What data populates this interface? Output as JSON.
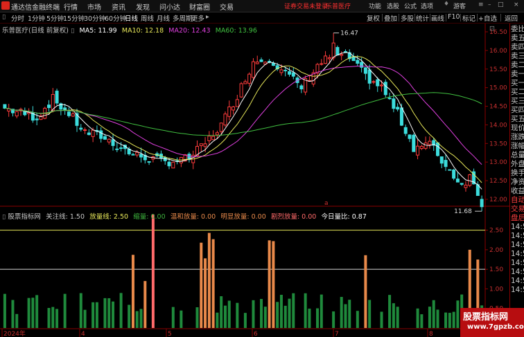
{
  "menubar": {
    "app_name": "通达信金融终端",
    "items": [
      "行情",
      "市场",
      "资讯",
      "发现",
      "问小达",
      "财富圈",
      "交易"
    ],
    "status": "证券交易未登录",
    "stock_link": "乐普医疗",
    "right_items": [
      "功能",
      "选股",
      "公式",
      "选项"
    ],
    "guest": "游客"
  },
  "periodbar": {
    "periods": [
      "分时",
      "1分钟",
      "5分钟",
      "15分钟",
      "30分钟",
      "60分钟",
      "日线",
      "周线",
      "月线",
      "多周期",
      "更多"
    ],
    "active": "日线",
    "tools": [
      "复权",
      "叠加",
      "多股",
      "统计",
      "画线",
      "F10",
      "标记",
      "+自选",
      "返回"
    ]
  },
  "chart": {
    "title": "乐普医疗(日线 前复权)",
    "ma": [
      {
        "label": "MA5: 11.99",
        "color": "#ffffff"
      },
      {
        "label": "MA10: 12.18",
        "color": "#e8e85a"
      },
      {
        "label": "MA20: 12.43",
        "color": "#e040e0"
      },
      {
        "label": "MA60: 13.96",
        "color": "#40c040"
      }
    ],
    "high_label": "16.47",
    "low_label": "11.68",
    "marker": "a",
    "price_ticks": [
      "16.50",
      "16.00",
      "15.50",
      "15.00",
      "14.50",
      "14.00",
      "13.50",
      "13.00",
      "12.50",
      "12.00"
    ],
    "date_labels": [
      "2024年",
      "4",
      "5",
      "6",
      "7",
      "8"
    ],
    "colors": {
      "up": "#ff3c3c",
      "down": "#3cdcdc",
      "volume_up": "#e8894a",
      "volume_down": "#1f8a3c",
      "volume_hot": "#ff6a6a",
      "grid": "#8b0000"
    }
  },
  "indicator": {
    "name": "股票指标网",
    "labels": [
      {
        "text": "关注线: 1.50",
        "color": "#c8c8c8"
      },
      {
        "text": "放量线: 2.50",
        "color": "#e8e85a"
      },
      {
        "text": "缩量: 0.00",
        "color": "#3cb03c"
      },
      {
        "text": "温和放量: 0.00",
        "color": "#e8894a"
      },
      {
        "text": "明显放量: 0.00",
        "color": "#e8894a"
      },
      {
        "text": "剧烈放量: 0.00",
        "color": "#ff6a6a"
      },
      {
        "text": "今日量比: 0.87",
        "color": "#ffffff"
      }
    ],
    "ticks": [
      "2.50",
      "2.00",
      "1.50",
      "1.00",
      "0.50"
    ],
    "line_high": 2.5,
    "line_low": 1.5
  },
  "rightpanel": {
    "items": [
      "委比",
      "卖五",
      "卖四",
      "卖三",
      "卖二",
      "卖一",
      "买一",
      "买二",
      "买三",
      "买四",
      "买五",
      "现价",
      "涨跌",
      "涨幅",
      "总量",
      "外盘",
      "换手",
      "净资",
      "收益",
      "自动",
      "交易",
      "盘后",
      "14:50",
      "14:50",
      "14:50",
      "14:50",
      "14:50",
      "14:50",
      "14:50",
      "14:5"
    ]
  },
  "watermark": {
    "title": "股票指标网",
    "url": "www.7gpzb.com"
  }
}
